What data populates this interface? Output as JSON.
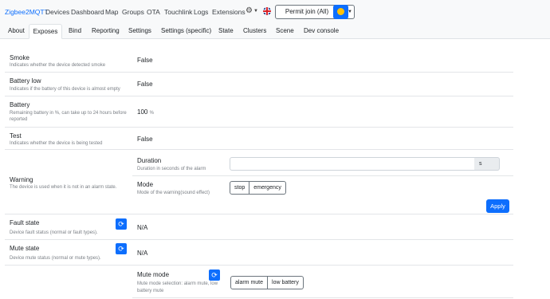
{
  "navbar": {
    "brand": "Zigbee2MQTT",
    "links": [
      "Devices",
      "Dashboard",
      "Map",
      "Groups",
      "OTA",
      "Touchlink",
      "Logs",
      "Extensions"
    ],
    "permit_join_label": "Permit join (All)"
  },
  "tabs": [
    "About",
    "Exposes",
    "Bind",
    "Reporting",
    "Settings",
    "Settings (specific)",
    "State",
    "Clusters",
    "Scene",
    "Dev console"
  ],
  "active_tab": "Exposes",
  "exposes": {
    "smoke": {
      "label": "Smoke",
      "description": "Indicates whether the device detected smoke",
      "value": "False"
    },
    "battery_low": {
      "label": "Battery low",
      "description": "Indicates if the battery of this device is almost empty",
      "value": "False"
    },
    "battery": {
      "label": "Battery",
      "description_line1": "Remaining battery in %, can take up to 24 hours before",
      "description_line2": "reported",
      "value": "100",
      "unit": "%"
    },
    "test": {
      "label": "Test",
      "description": "Indicates whether the device is being tested",
      "value": "False"
    },
    "warning": {
      "label": "Warning",
      "description": "The device is used when it is not in an alarm state.",
      "duration": {
        "label": "Duration",
        "description": "Duration in seconds of the alarm",
        "value": "",
        "unit": "s"
      },
      "mode": {
        "label": "Mode",
        "description": "Mode of the warning(sound effect)",
        "options": [
          "stop",
          "emergency"
        ]
      },
      "apply_label": "Apply"
    },
    "fault_state": {
      "label": "Fault state",
      "description": "Device fault status (normal or fault types).",
      "value": "N/A"
    },
    "mute_state": {
      "label": "Mute state",
      "description": "Device mute status (normal or mute types).",
      "value": "N/A"
    },
    "mute_mode": {
      "label": "Mute mode",
      "description_line1": "Mute mode selection: alarm mute, low",
      "description_line2": "battery mute",
      "options": [
        "alarm mute",
        "low battery"
      ]
    }
  },
  "colors": {
    "primary": "#0d6efd",
    "navbar_bg": "#f8f9fa",
    "muted_text": "#7a7f85"
  },
  "icons": [
    "gear-icon",
    "uk-flag-icon",
    "smiley-icon",
    "refresh-icon"
  ]
}
